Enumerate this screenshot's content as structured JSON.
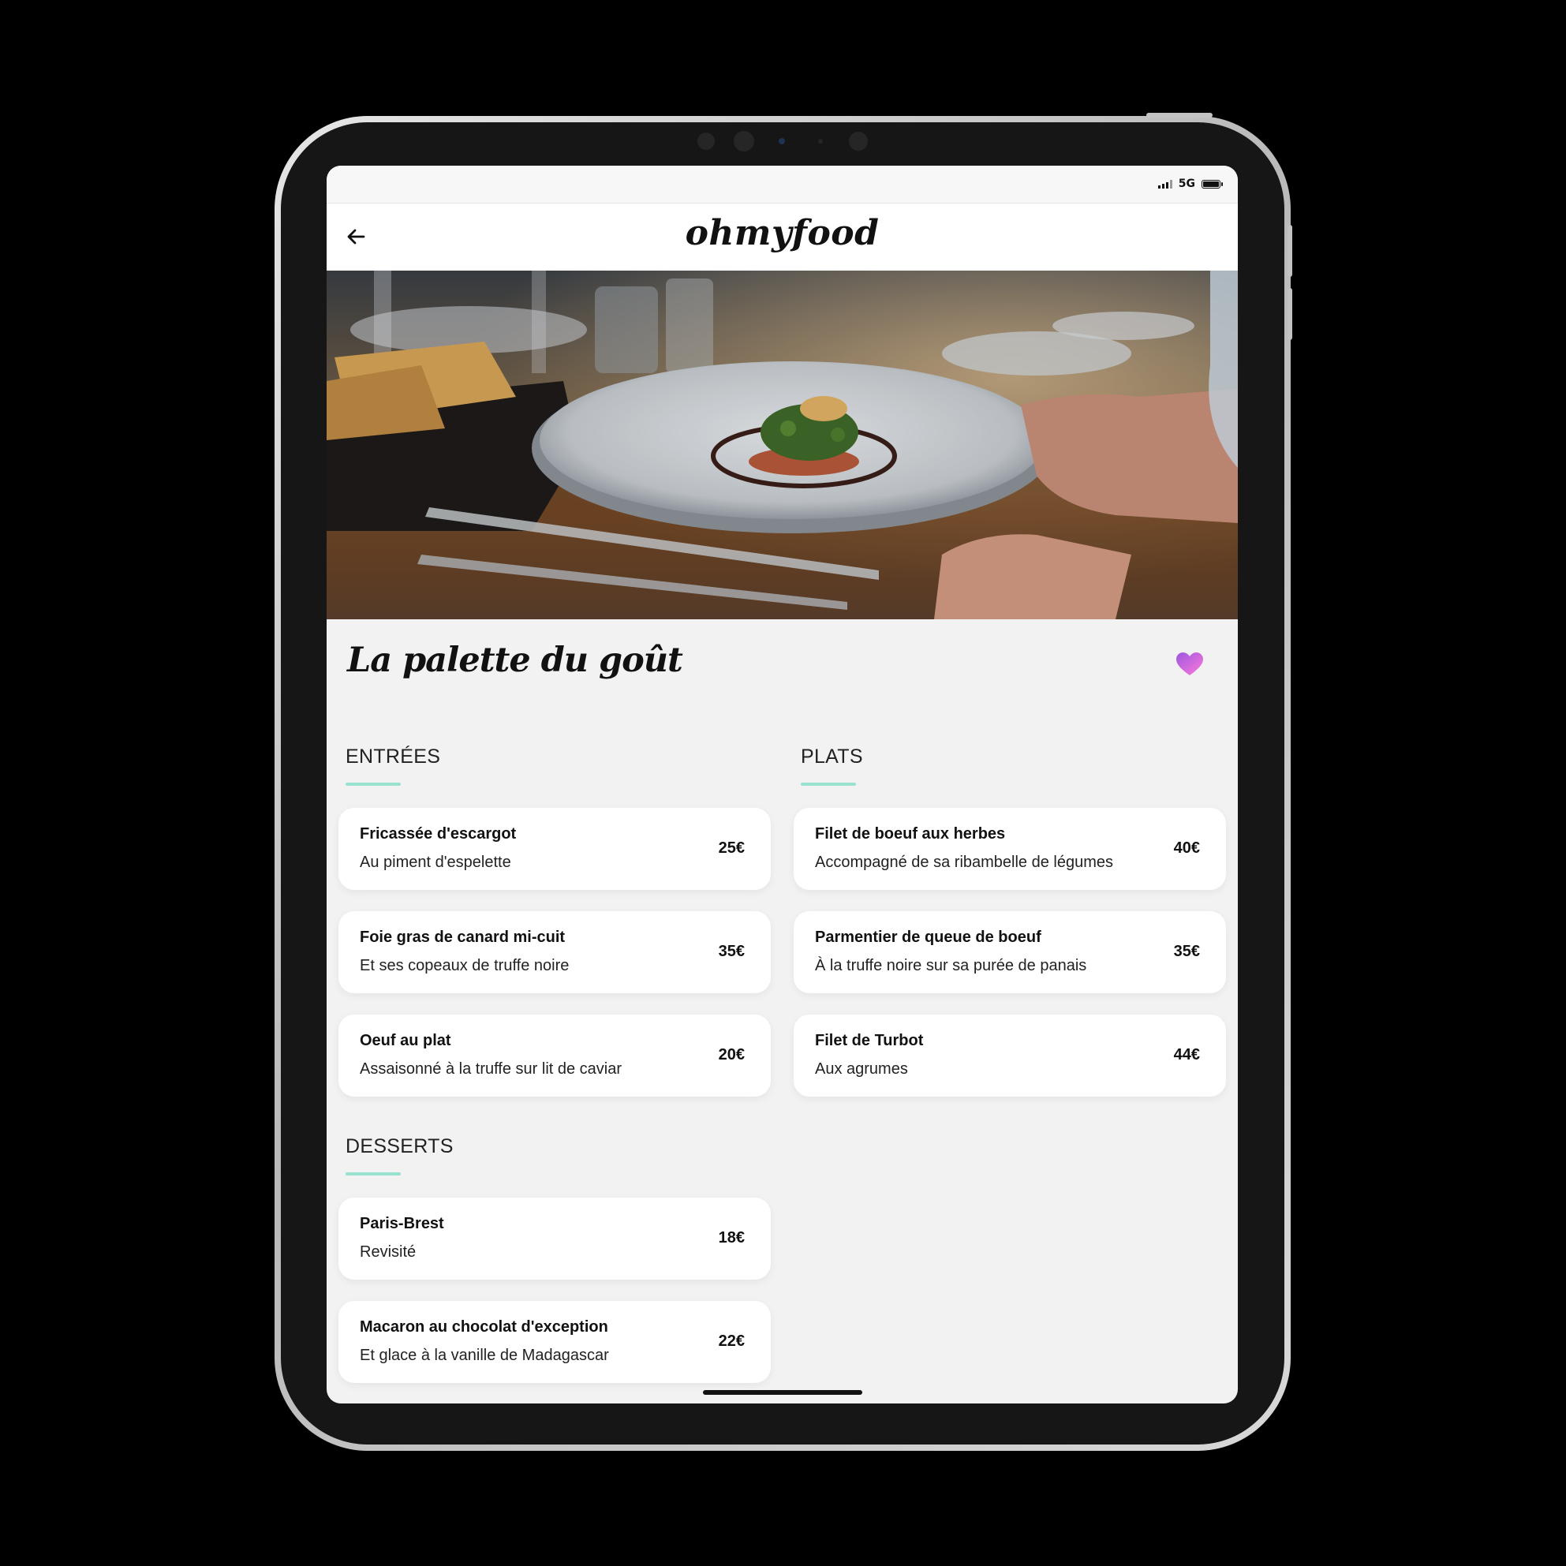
{
  "status_bar": {
    "network": "5G"
  },
  "header": {
    "logo": "ohmyfood"
  },
  "restaurant": {
    "name": "La palette du goût"
  },
  "colors": {
    "accent_underline": "#99e2d0",
    "heart": "#c86ce0",
    "card": "#ffffff",
    "background": "#f2f2f2"
  },
  "menu": {
    "entrees": {
      "title": "ENTRÉES",
      "items": [
        {
          "name": "Fricassée d'escargot",
          "desc": "Au piment d'espelette",
          "price": "25€"
        },
        {
          "name": "Foie gras de canard mi-cuit",
          "desc": "Et ses copeaux de truffe noire",
          "price": "35€"
        },
        {
          "name": "Oeuf au plat",
          "desc": "Assaisonné à la truffe sur lit de caviar",
          "price": "20€"
        }
      ]
    },
    "plats": {
      "title": "PLATS",
      "items": [
        {
          "name": "Filet de boeuf aux herbes",
          "desc": "Accompagné de sa ribambelle de légumes",
          "price": "40€"
        },
        {
          "name": "Parmentier de queue de boeuf",
          "desc": "À la truffe noire sur sa purée de panais",
          "price": "35€"
        },
        {
          "name": "Filet de Turbot",
          "desc": "Aux agrumes",
          "price": "44€"
        }
      ]
    },
    "desserts": {
      "title": "DESSERTS",
      "items": [
        {
          "name": "Paris-Brest",
          "desc": "Revisité",
          "price": "18€"
        },
        {
          "name": "Macaron au chocolat d'exception",
          "desc": "Et glace à la vanille de Madagascar",
          "price": "22€"
        }
      ]
    }
  },
  "icons": {
    "back": "arrow-left-icon",
    "favorite": "heart-icon",
    "signal": "signal-icon",
    "battery": "battery-icon"
  }
}
